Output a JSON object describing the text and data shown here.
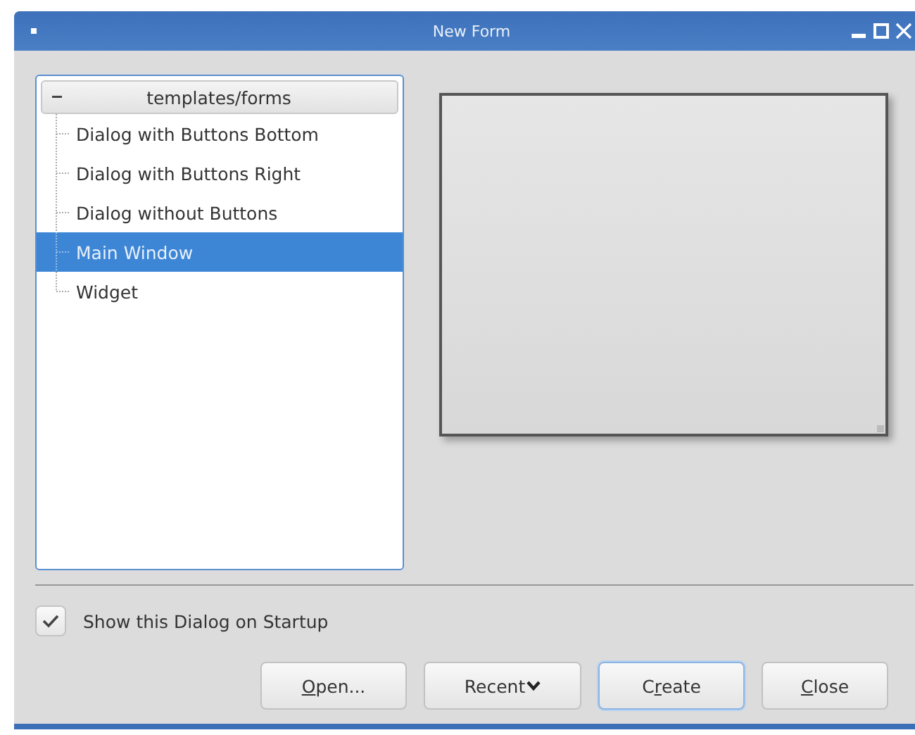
{
  "window": {
    "title": "New Form"
  },
  "tree": {
    "label": "templates/forms",
    "expanded": true,
    "children": [
      {
        "label": "Dialog with Buttons Bottom",
        "selected": false
      },
      {
        "label": "Dialog with Buttons Right",
        "selected": false
      },
      {
        "label": "Dialog without Buttons",
        "selected": false
      },
      {
        "label": "Main Window",
        "selected": true
      },
      {
        "label": "Widget",
        "selected": false
      }
    ]
  },
  "startup_checkbox": {
    "label": "Show this Dialog on Startup",
    "checked": true
  },
  "buttons": [
    {
      "kind": "plain",
      "mnemonic": "O",
      "after": "pen...",
      "default": false
    },
    {
      "kind": "menu",
      "before": "Recent",
      "default": false
    },
    {
      "kind": "plain",
      "before": "C",
      "mnemonic": "r",
      "after": "eate",
      "default": true
    },
    {
      "kind": "plain",
      "mnemonic": "C",
      "after": "lose",
      "default": false
    }
  ]
}
